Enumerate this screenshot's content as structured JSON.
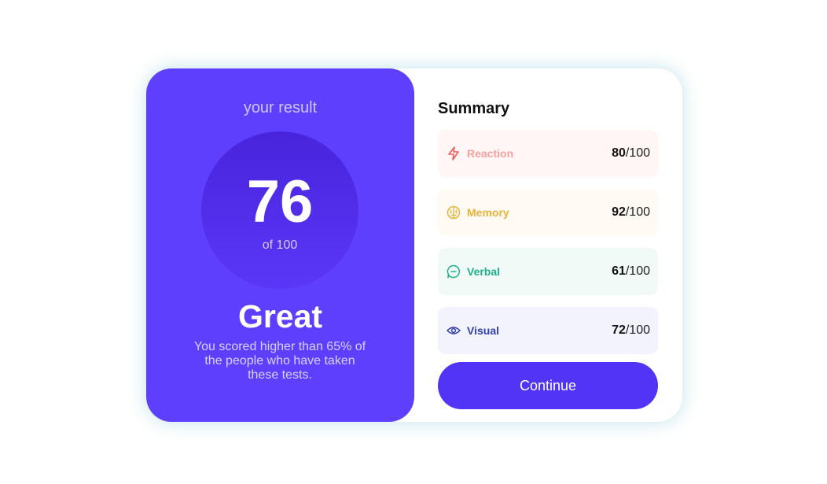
{
  "result": {
    "heading": "your result",
    "score": "76",
    "total": "of 100",
    "rating": "Great",
    "description": "You scored higher than 65% of the people who have taken these tests."
  },
  "summary": {
    "title": "Summary",
    "items": [
      {
        "label": "Reaction",
        "score": "80",
        "max": "/100",
        "icon": "lightning-icon",
        "accent": "#f55a5a",
        "background": "#fff6f5"
      },
      {
        "label": "Memory",
        "score": "92",
        "max": "/100",
        "icon": "brain-icon",
        "accent": "#e8b43a",
        "background": "#fffbf4"
      },
      {
        "label": "Verbal",
        "score": "61",
        "max": "/100",
        "icon": "chat-bubble-icon",
        "accent": "#1fb18a",
        "background": "#f2faf8"
      },
      {
        "label": "Visual",
        "score": "72",
        "max": "/100",
        "icon": "eye-icon",
        "accent": "#2f3ea8",
        "background": "#f2f3fd"
      }
    ]
  },
  "continue_label": "Continue",
  "colors": {
    "result_panel": "#5e3ffd",
    "button": "#5234f7"
  }
}
